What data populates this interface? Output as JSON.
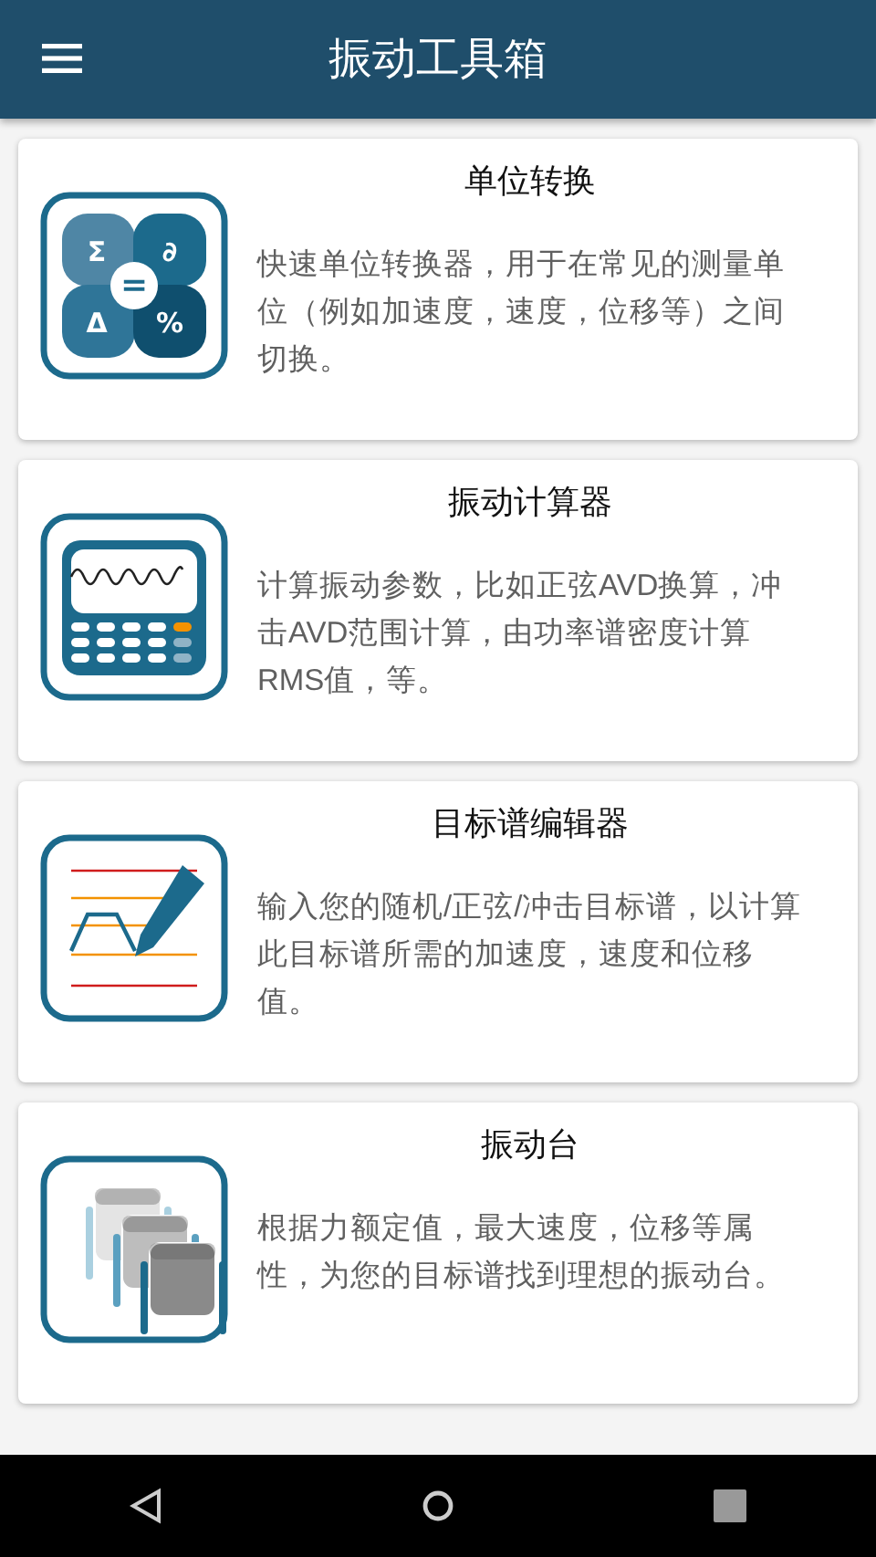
{
  "app_bar": {
    "title": "振动工具箱"
  },
  "tools": [
    {
      "kind": "converter",
      "title": "单位转换",
      "description": "快速单位转换器，用于在常见的测量单位（例如加速度，速度，位移等）之间切换。",
      "symbols": [
        "Σ",
        "∂",
        "Δ",
        "%",
        "="
      ]
    },
    {
      "kind": "calculator",
      "title": "振动计算器",
      "description": "计算振动参数，比如正弦AVD换算，冲击AVD范围计算，由功率谱密度计算RMS值，等。"
    },
    {
      "kind": "editor",
      "title": "目标谱编辑器",
      "description": "输入您的随机/正弦/冲击目标谱，以计算此目标谱所需的加速度，速度和位移值。"
    },
    {
      "kind": "shaker",
      "title": "振动台",
      "description": "根据力额定值，最大速度，位移等属性，为您的目标谱找到理想的振动台。"
    }
  ]
}
